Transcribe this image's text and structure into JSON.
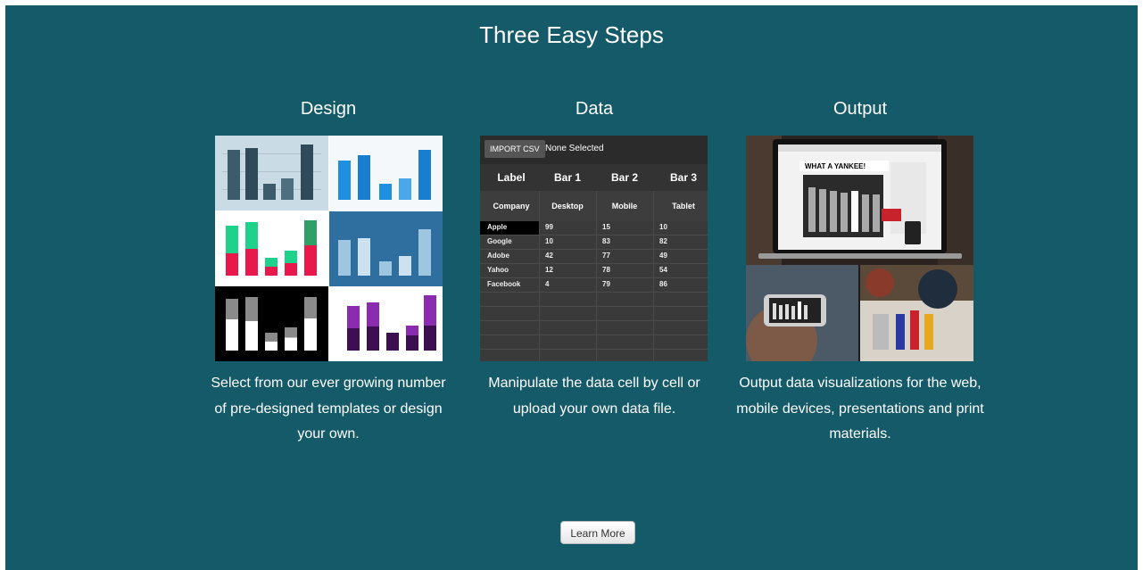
{
  "heading": "Three Easy Steps",
  "steps": [
    {
      "title": "Design",
      "description": "Select from our ever growing number of pre-designed templates or design your own."
    },
    {
      "title": "Data",
      "description": "Manipulate the data cell by cell or upload your own data file."
    },
    {
      "title": "Output",
      "description": "Output data visualizations for the web, mobile devices, presentations and print materials."
    }
  ],
  "data_editor": {
    "import_label": "IMPORT CSV",
    "selection_status": "None Selected",
    "headers": [
      "Label",
      "Bar 1",
      "Bar 2",
      "Bar 3"
    ],
    "subheaders": [
      "Company",
      "Desktop",
      "Mobile",
      "Tablet"
    ],
    "rows": [
      [
        "Apple",
        "99",
        "15",
        "10"
      ],
      [
        "Google",
        "10",
        "83",
        "82"
      ],
      [
        "Adobe",
        "42",
        "77",
        "49"
      ],
      [
        "Yahoo",
        "12",
        "78",
        "54"
      ],
      [
        "Facebook",
        "4",
        "79",
        "86"
      ]
    ]
  },
  "output_preview": {
    "newspaper_headline": "WHAT A YANKEE!"
  },
  "learn_more_label": "Learn More",
  "colors": {
    "panel_bg": "#145a69",
    "text": "#ffffff"
  }
}
